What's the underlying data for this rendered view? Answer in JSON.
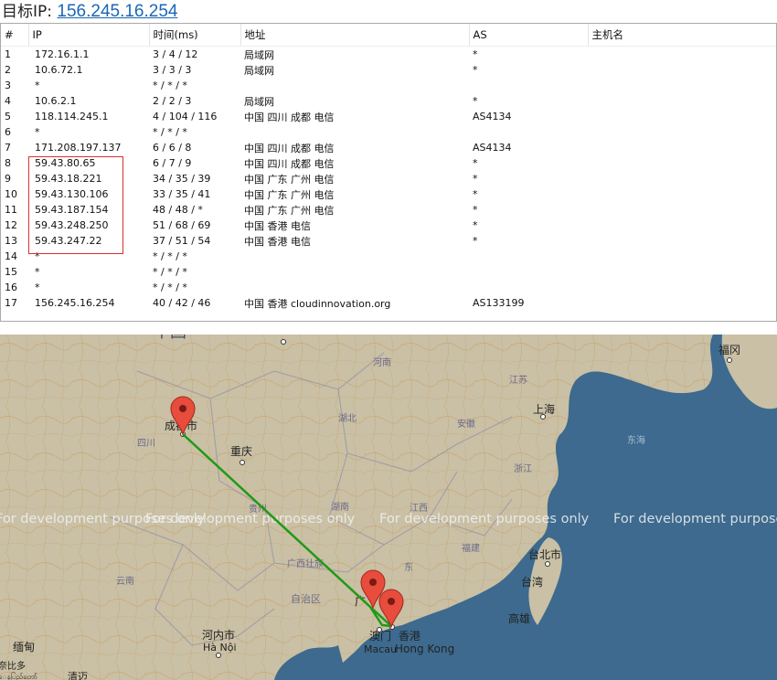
{
  "target": {
    "label": "目标IP:",
    "ip": "156.245.16.254"
  },
  "columns": [
    "#",
    "IP",
    "时间(ms)",
    "地址",
    "AS",
    "主机名"
  ],
  "rows": [
    {
      "n": "1",
      "ip": "172.16.1.1",
      "time": "3 / 4 / 12",
      "addr": "局域网",
      "as": "*",
      "host": ""
    },
    {
      "n": "2",
      "ip": "10.6.72.1",
      "time": "3 / 3 / 3",
      "addr": "局域网",
      "as": "*",
      "host": ""
    },
    {
      "n": "3",
      "ip": "*",
      "time": "* / * / *",
      "addr": "",
      "as": "",
      "host": ""
    },
    {
      "n": "4",
      "ip": "10.6.2.1",
      "time": "2 / 2 / 3",
      "addr": "局域网",
      "as": "*",
      "host": ""
    },
    {
      "n": "5",
      "ip": "118.114.245.1",
      "time": "4 / 104 / 116",
      "addr": "中国 四川 成都 电信",
      "as": "AS4134",
      "host": ""
    },
    {
      "n": "6",
      "ip": "*",
      "time": "* / * / *",
      "addr": "",
      "as": "",
      "host": ""
    },
    {
      "n": "7",
      "ip": "171.208.197.137",
      "time": "6 / 6 / 8",
      "addr": "中国 四川 成都 电信",
      "as": "AS4134",
      "host": ""
    },
    {
      "n": "8",
      "ip": "59.43.80.65",
      "time": "6 / 7 / 9",
      "addr": "中国 四川 成都 电信",
      "as": "*",
      "host": ""
    },
    {
      "n": "9",
      "ip": "59.43.18.221",
      "time": "34 / 35 / 39",
      "addr": "中国 广东 广州 电信",
      "as": "*",
      "host": ""
    },
    {
      "n": "10",
      "ip": "59.43.130.106",
      "time": "33 / 35 / 41",
      "addr": "中国 广东 广州 电信",
      "as": "*",
      "host": ""
    },
    {
      "n": "11",
      "ip": "59.43.187.154",
      "time": "48 / 48 / *",
      "addr": "中国 广东 广州 电信",
      "as": "*",
      "host": ""
    },
    {
      "n": "12",
      "ip": "59.43.248.250",
      "time": "51 / 68 / 69",
      "addr": "中国 香港 电信",
      "as": "*",
      "host": ""
    },
    {
      "n": "13",
      "ip": "59.43.247.22",
      "time": "37 / 51 / 54",
      "addr": "中国 香港 电信",
      "as": "*",
      "host": ""
    },
    {
      "n": "14",
      "ip": "*",
      "time": "* / * / *",
      "addr": "",
      "as": "",
      "host": ""
    },
    {
      "n": "15",
      "ip": "*",
      "time": "* / * / *",
      "addr": "",
      "as": "",
      "host": ""
    },
    {
      "n": "16",
      "ip": "*",
      "time": "* / * / *",
      "addr": "",
      "as": "",
      "host": ""
    },
    {
      "n": "17",
      "ip": "156.245.16.254",
      "time": "40 / 42 / 46",
      "addr": "中国 香港 cloudinnovation.org",
      "as": "AS133199",
      "host": ""
    }
  ],
  "map": {
    "watermark": "For development purposes only",
    "labels": {
      "zhongguo": "中国",
      "chengdu": "成都市",
      "chongqing": "重庆",
      "sichuan": "四川",
      "hubei": "湖北",
      "henan": "河南",
      "anhui": "安徽",
      "jiangsu": "江苏",
      "shanghai": "上海",
      "zhejiang": "浙江",
      "donghai": "东海",
      "hunan": "湖南",
      "jiangxi": "江西",
      "guizhou": "贵州",
      "fujian": "福建",
      "yunnan": "云南",
      "guangxi1": "广西壮族",
      "guangxi2": "自治区",
      "guangdong": "广",
      "dong": "东",
      "fukuoka": "福冈",
      "taipei": "台北市",
      "taiwan": "台湾",
      "kaohsiung": "高雄",
      "hanoi_cn": "河内市",
      "hanoi": "Hà Nội",
      "macau_cn": "澳门",
      "macau": "Macau",
      "hk_cn": "香港",
      "hk": "Hong Kong",
      "myanmar": "缅甸",
      "laos1": "奈比多",
      "laos2": "ေနပြည်တော်",
      "tongyi": "清迈"
    },
    "colors": {
      "route": "#1f9a15",
      "marker": "#e74c3c",
      "land": "#c9c0a5",
      "sea": "#3d6a8e"
    }
  }
}
